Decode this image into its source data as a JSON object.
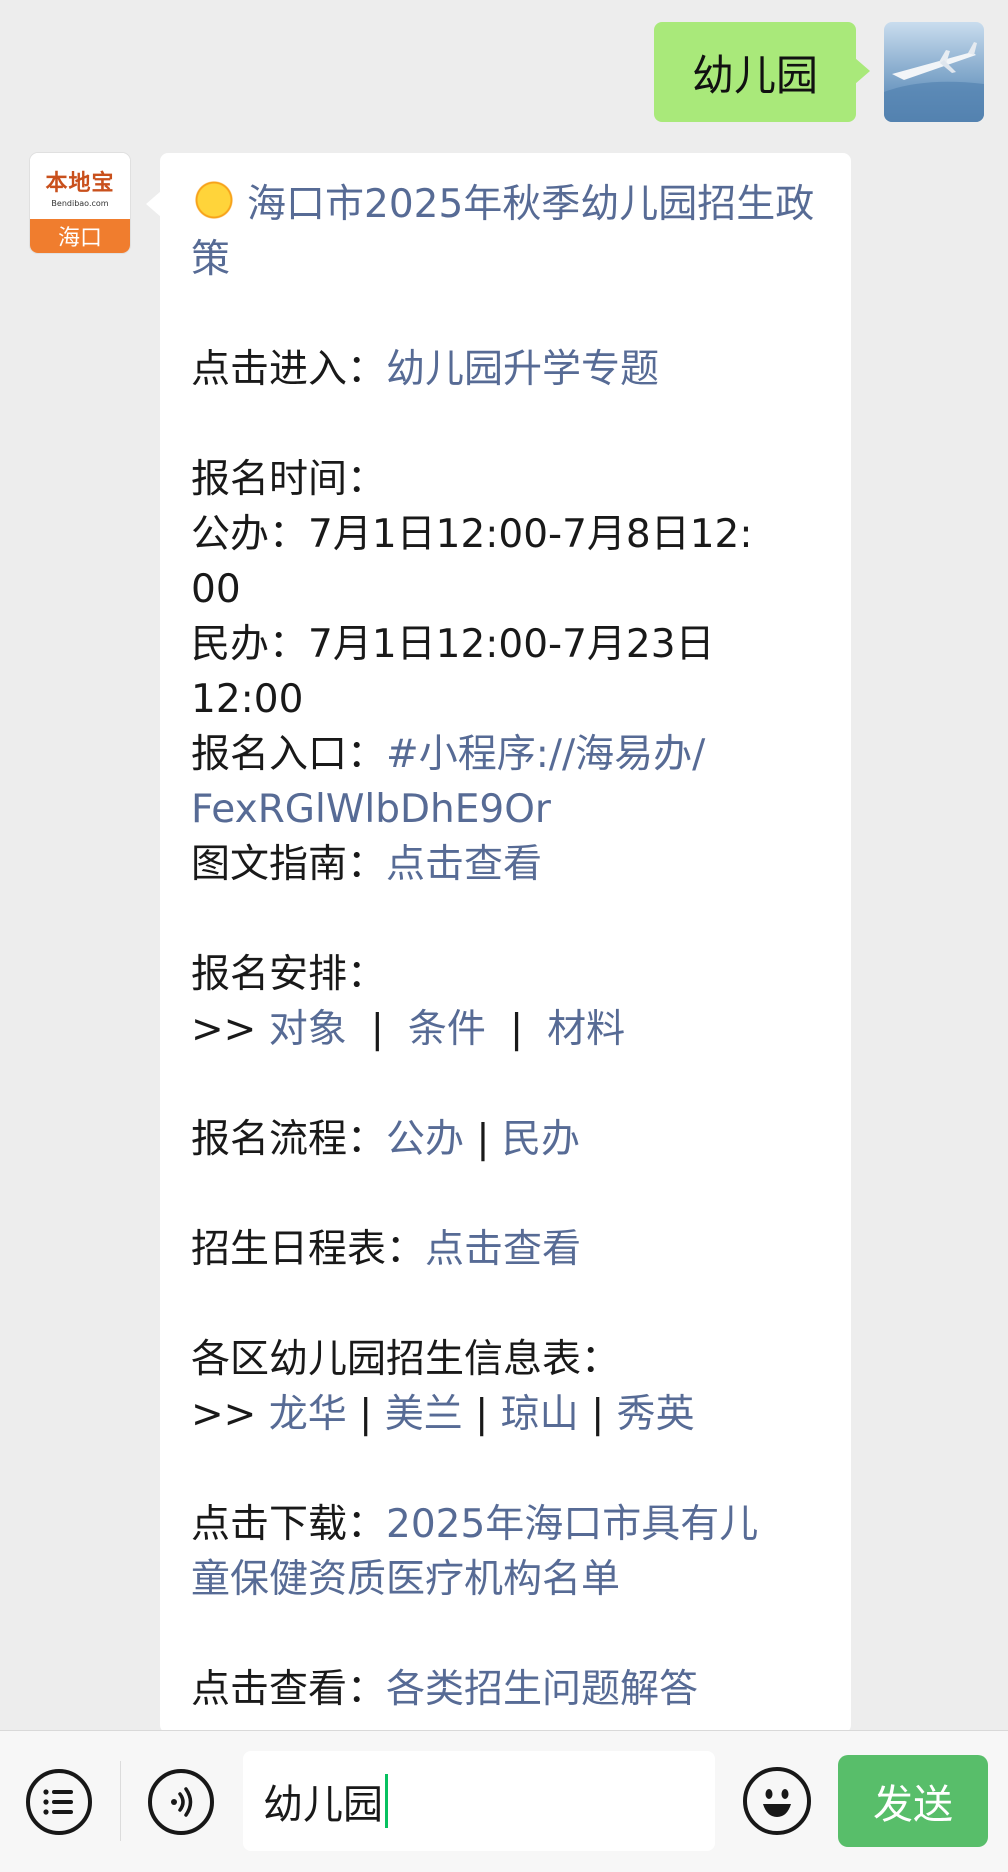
{
  "outgoing": {
    "text": "幼儿园"
  },
  "bot": {
    "brand": "本地宝",
    "brand_sub": "Bendibao.com",
    "city": "海口"
  },
  "message": {
    "title": "海口市2025年秋季幼儿园招生政策",
    "entry_label": "点击进入：",
    "entry_link": "幼儿园升学专题",
    "time_heading": "报名时间：",
    "time_public_1": "公办：7月1日12:00-7月8日12:",
    "time_public_2": "00",
    "time_private_1": "民办：7月1日12:00-7月23日",
    "time_private_2": "12:00",
    "entrance_label": "报名入口：",
    "entrance_link_1": "#小程序://海易办/",
    "entrance_link_2": "FexRGlWlbDhE9Or",
    "guide_label": "图文指南：",
    "guide_link": "点击查看",
    "arrange_heading": "报名安排：",
    "arrange_prefix": ">> ",
    "arrange_links": [
      "对象",
      "条件",
      "材料"
    ],
    "flow_label": "报名流程：",
    "flow_links": [
      "公办",
      "民办"
    ],
    "schedule_label": "招生日程表：",
    "schedule_link": "点击查看",
    "district_heading": "各区幼儿园招生信息表：",
    "district_prefix": ">> ",
    "district_links": [
      "龙华",
      "美兰",
      "琼山",
      "秀英"
    ],
    "download_label": "点击下载：",
    "download_link_1": "2025年海口市具有儿",
    "download_link_2": "童保健资质医疗机构名单",
    "faq_label": "点击查看：",
    "faq_link": "各类招生问题解答"
  },
  "input": {
    "value": "幼儿园",
    "send_label": "发送"
  },
  "colors": {
    "link": "#576b95",
    "send": "#58be6a",
    "outgoing": "#a9e97a",
    "caret": "#07c160"
  }
}
